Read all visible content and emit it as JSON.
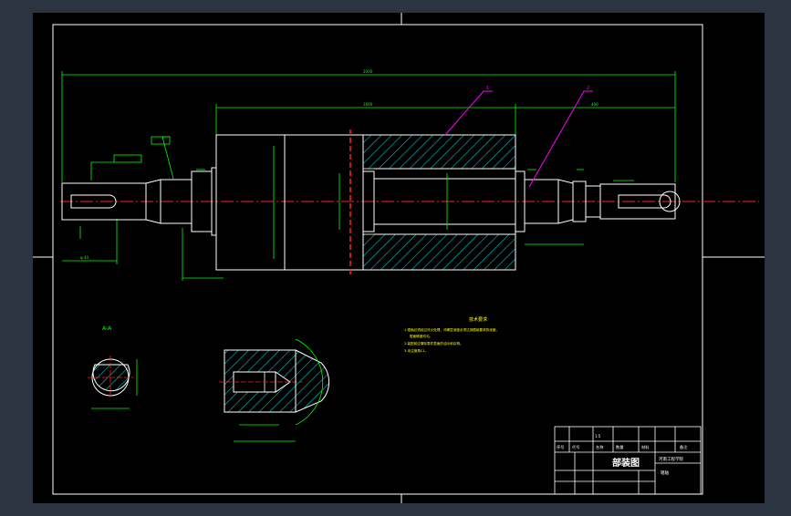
{
  "drawing": {
    "title_main": "部装图",
    "scale_note": "1:5",
    "school": "河南工程学院",
    "drawing_no": "辊轴",
    "section_label": "A-A",
    "part_refs": [
      "1",
      "2"
    ],
    "notes_title": "技术要求",
    "notes": [
      "1.辊面必须经过淬火处理，淬硬层深度必须达到图纸要求的深度，",
      "辊面硬度均匀。",
      "2.装配前应清除零件表面的油污和杂物。",
      "3.未注倒角C1。"
    ],
    "title_block": {
      "headers": [
        "序号",
        "代号",
        "名称",
        "数量",
        "材料",
        "备注"
      ]
    },
    "colors": {
      "background": "#2b3440",
      "sheet": "#000000",
      "outline": "#ffffff",
      "dimension": "#00ff00",
      "hatch": "#00ffff",
      "centerline": "#ff0000",
      "leader": "#ff00ff",
      "note_text": "#ffff00"
    }
  }
}
